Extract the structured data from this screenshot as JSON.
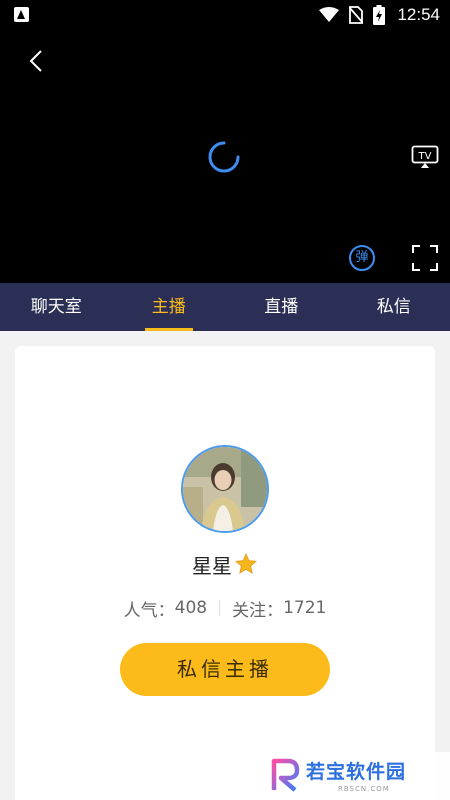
{
  "status_bar": {
    "time": "12:54",
    "icons": [
      "app-notification-icon",
      "wifi-icon",
      "no-sim-icon",
      "battery-charging-icon"
    ]
  },
  "player": {
    "state": "loading",
    "danmu_label": "弹",
    "tv_label": "TV",
    "icons": [
      "back-arrow-icon",
      "loading-spinner-icon",
      "tv-cast-icon",
      "danmu-toggle-icon",
      "fullscreen-icon"
    ]
  },
  "tabs": [
    {
      "label": "聊天室",
      "active": false
    },
    {
      "label": "主播",
      "active": true
    },
    {
      "label": "直播",
      "active": false
    },
    {
      "label": "私信",
      "active": false
    }
  ],
  "anchor": {
    "name": "星星",
    "popularity_label": "人气：",
    "popularity": "408",
    "follow_label": "关注：",
    "follow": "1721",
    "dm_button": "私信主播"
  },
  "watermark": {
    "text": "若宝软件园",
    "sub": "RBSCN.COM"
  },
  "colors": {
    "tab_bar": "#2c2f55",
    "accent": "#fdbb1b",
    "avatar_ring": "#4b9bf0",
    "spinner": "#3d8ef0"
  }
}
